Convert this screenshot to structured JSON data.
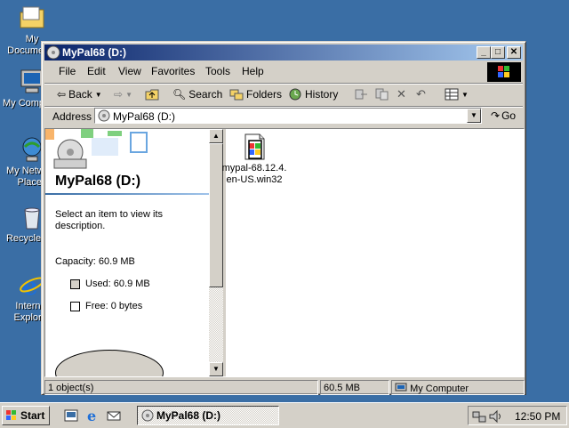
{
  "desktop": {
    "icons": [
      {
        "label": "My Documents",
        "icon": "folder-icon"
      },
      {
        "label": "My Computer",
        "icon": "computer-icon"
      },
      {
        "label": "My Network Places",
        "icon": "network-icon"
      },
      {
        "label": "Recycle Bin",
        "icon": "recycle-bin-icon"
      },
      {
        "label": "Internet Explorer",
        "icon": "ie-icon"
      }
    ]
  },
  "window": {
    "title": "MyPal68 (D:)",
    "buttons": {
      "minimize": "_",
      "maximize": "□",
      "close": "✕"
    }
  },
  "menu": [
    "File",
    "Edit",
    "View",
    "Favorites",
    "Tools",
    "Help"
  ],
  "toolbar": {
    "back": "Back",
    "search": "Search",
    "folders": "Folders",
    "history": "History"
  },
  "address": {
    "label": "Address",
    "value": "MyPal68 (D:)",
    "go": "Go"
  },
  "leftpane": {
    "drive_title": "MyPal68 (D:)",
    "description": "Select an item to view its description.",
    "capacity": "Capacity: 60.9 MB",
    "used": "Used: 60.9 MB",
    "free": "Free: 0 bytes"
  },
  "files": [
    {
      "name": "mypal-68.12.4.en-US.win32",
      "icon": "installer-icon"
    }
  ],
  "status": {
    "objects": "1 object(s)",
    "size": "60.5 MB",
    "zone": "My Computer"
  },
  "taskbar": {
    "start": "Start",
    "task": "MyPal68 (D:)",
    "clock": "12:50 PM"
  },
  "colors": {
    "desktop": "#3a6ea5",
    "title_start": "#0a246a",
    "title_end": "#a6caf0",
    "face": "#d4d0c8"
  }
}
